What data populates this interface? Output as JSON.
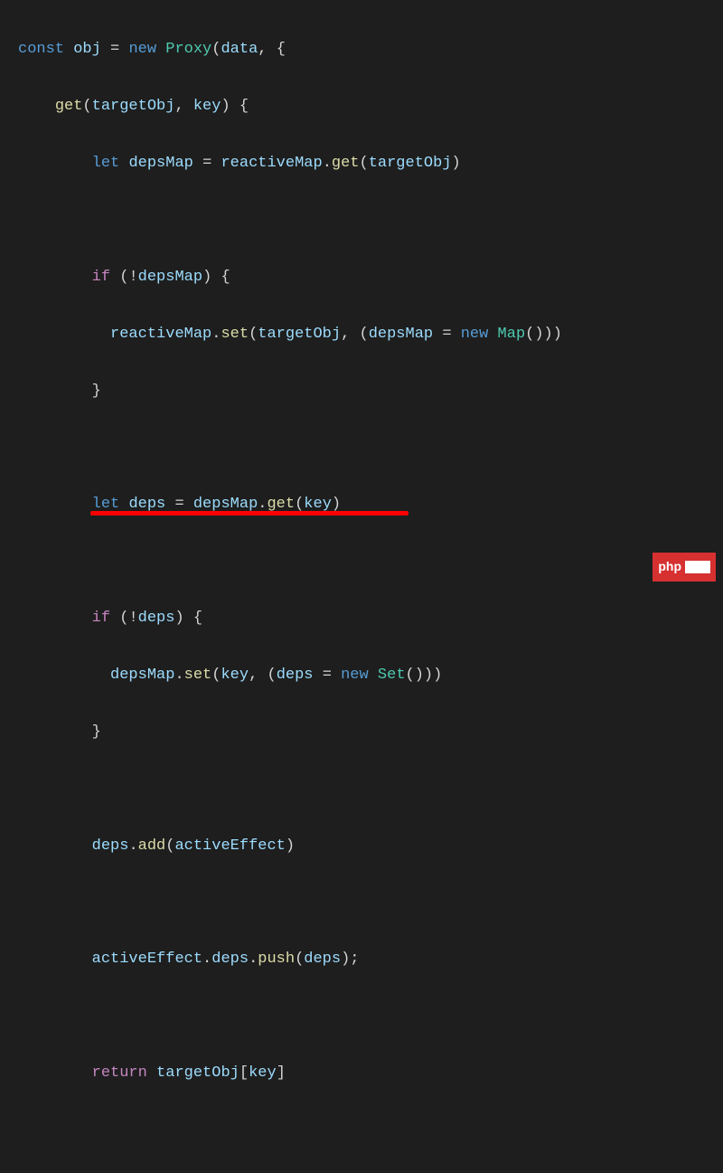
{
  "code": {
    "tokens": {
      "const": "const",
      "obj": "obj",
      "eq": "=",
      "new": "new",
      "Proxy": "Proxy",
      "data": "data",
      "get": "get",
      "targetObj": "targetObj",
      "key": "key",
      "let": "let",
      "depsMap": "depsMap",
      "reactiveMap": "reactiveMap",
      "getMethod": "get",
      "if": "if",
      "notDepsMap": "!depsMap",
      "set": "set",
      "Map": "Map",
      "deps": "deps",
      "notDeps": "!deps",
      "Set": "Set",
      "add": "add",
      "activeEffect": "activeEffect",
      "push": "push",
      "return": "return"
    },
    "highlighted_line": "activeEffect.deps.push(deps);"
  },
  "watermark": {
    "text": "php"
  }
}
